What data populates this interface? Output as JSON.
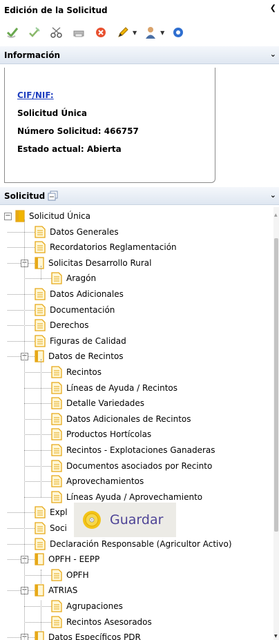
{
  "edicion": {
    "title": "Edición de la Solicitud",
    "collapse_glyph": "❮"
  },
  "toolbar": {
    "buttons": [
      {
        "icon": "check-icon"
      },
      {
        "icon": "edit-check-icon"
      },
      {
        "icon": "scissors-icon"
      },
      {
        "icon": "print-icon"
      },
      {
        "icon": "cancel-icon"
      },
      {
        "icon": "pencil-icon",
        "dropdown": true
      },
      {
        "icon": "user-icon",
        "dropdown": true
      },
      {
        "icon": "info-icon"
      }
    ]
  },
  "informacion": {
    "title": "Información",
    "cif_link": "CIF/NIF:",
    "solicitud": "Solicitud Única",
    "numero": "Número Solicitud: 466757",
    "estado": "Estado actual: Abierta"
  },
  "solicitud_header": {
    "title": "Solicitud"
  },
  "tree": {
    "root": "Solicitud Única",
    "items": [
      {
        "label": "Solicitud Única",
        "level": 0,
        "type": "folder",
        "expander": "−"
      },
      {
        "label": "Datos Generales",
        "level": 1,
        "type": "doc"
      },
      {
        "label": "Recordatorios Reglamentación",
        "level": 1,
        "type": "doc"
      },
      {
        "label": "Solicitas Desarrollo Rural",
        "level": 1,
        "type": "folder",
        "expander": "−"
      },
      {
        "label": "Aragón",
        "level": 2,
        "type": "doc"
      },
      {
        "label": "Datos Adicionales",
        "level": 1,
        "type": "doc"
      },
      {
        "label": "Documentación",
        "level": 1,
        "type": "doc"
      },
      {
        "label": "Derechos",
        "level": 1,
        "type": "doc"
      },
      {
        "label": "Figuras de Calidad",
        "level": 1,
        "type": "doc"
      },
      {
        "label": "Datos de Recintos",
        "level": 1,
        "type": "folder",
        "expander": "−"
      },
      {
        "label": "Recintos",
        "level": 2,
        "type": "doc"
      },
      {
        "label": "Líneas de Ayuda / Recintos",
        "level": 2,
        "type": "doc"
      },
      {
        "label": "Detalle Variedades",
        "level": 2,
        "type": "doc"
      },
      {
        "label": "Datos Adicionales de Recintos",
        "level": 2,
        "type": "doc"
      },
      {
        "label": "Productos Hortícolas",
        "level": 2,
        "type": "doc"
      },
      {
        "label": "Recintos - Explotaciones Ganaderas",
        "level": 2,
        "type": "doc"
      },
      {
        "label": "Documentos asociados por Recinto",
        "level": 2,
        "type": "doc"
      },
      {
        "label": "Aprovechamientos",
        "level": 2,
        "type": "doc"
      },
      {
        "label": "Líneas Ayuda / Aprovechamiento",
        "level": 2,
        "type": "doc"
      },
      {
        "label": "Expl",
        "level": 1,
        "type": "doc"
      },
      {
        "label": "Soci",
        "level": 1,
        "type": "doc"
      },
      {
        "label": "Declaración Responsable (Agricultor Activo)",
        "level": 1,
        "type": "doc"
      },
      {
        "label": "OPFH - EEPP",
        "level": 1,
        "type": "folder",
        "expander": "−"
      },
      {
        "label": "OPFH",
        "level": 2,
        "type": "doc"
      },
      {
        "label": "ATRIAS",
        "level": 1,
        "type": "folder",
        "expander": "−"
      },
      {
        "label": "Agrupaciones",
        "level": 2,
        "type": "doc"
      },
      {
        "label": "Recintos Asesorados",
        "level": 2,
        "type": "doc"
      },
      {
        "label": "Datos Específicos PDR",
        "level": 1,
        "type": "folder",
        "expander": "−"
      }
    ]
  },
  "guardar": {
    "label": "Guardar",
    "icon": "save-disc-icon"
  },
  "colors": {
    "link": "#1f3fbf",
    "guardar_text": "#4d4396",
    "doc_icon": "#e6a817",
    "header_bg": "#dfe7f1"
  }
}
